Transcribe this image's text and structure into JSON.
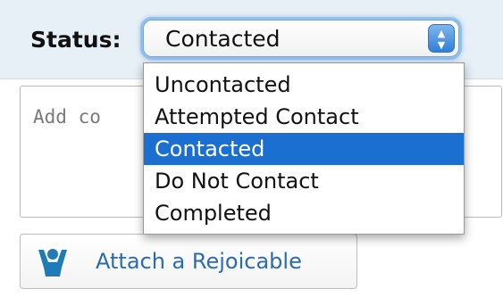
{
  "status": {
    "label": "Status:",
    "selected": "Contacted",
    "options": [
      {
        "label": "Uncontacted"
      },
      {
        "label": "Attempted Contact"
      },
      {
        "label": "Contacted",
        "selected": true
      },
      {
        "label": "Do Not Contact"
      },
      {
        "label": "Completed"
      }
    ]
  },
  "comment": {
    "placeholder": "Add co"
  },
  "attach": {
    "label": "Attach a Rejoicable",
    "icon": "person-arms-up-icon"
  },
  "colors": {
    "accent": "#1b6fd1",
    "link": "#2b6cb0",
    "focus_ring": "#8ec0f0",
    "status_bar_bg": "#e8f0f7",
    "icon": "#1f7bb8"
  }
}
